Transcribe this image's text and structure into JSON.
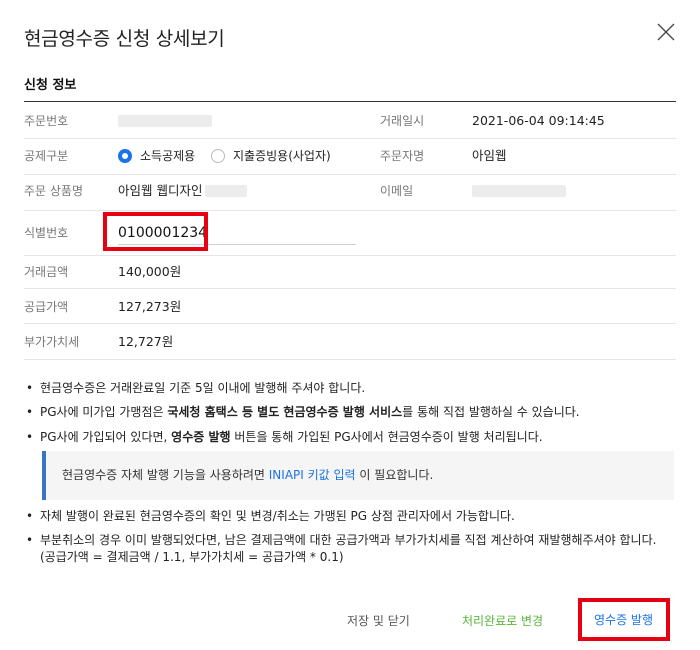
{
  "header": {
    "title": "현금영수증 신청 상세보기",
    "close_icon": "close-icon"
  },
  "section": {
    "title": "신청 정보"
  },
  "fields": {
    "order_no_label": "주문번호",
    "trade_date_label": "거래일시",
    "trade_date_value": "2021-06-04 09:14:45",
    "deduction_label": "공제구분",
    "deduction_options": [
      "소득공제용",
      "지출증빙용(사업자)"
    ],
    "orderer_label": "주문자명",
    "orderer_value": "아임웹",
    "product_label": "주문 상품명",
    "product_value": "아임웹 웹디자인",
    "email_label": "이메일",
    "id_label": "식별번호",
    "id_value": "0100001234",
    "amount_label": "거래금액",
    "amount_value": "140,000원",
    "supply_label": "공급가액",
    "supply_value": "127,273원",
    "vat_label": "부가가치세",
    "vat_value": "12,727원"
  },
  "notes": {
    "b1": "현금영수증은 거래완료일 기준 5일 이내에 발행해 주셔야 합니다.",
    "b2_pre": "PG사에 미가입 가맹점은 ",
    "b2_bold": "국세청 홈택스 등 별도 현금영수증 발행 서비스",
    "b2_post": "를 통해 직접 발행하실 수 있습니다.",
    "b3_pre": "PG사에 가입되어 있다면, ",
    "b3_bold": "영수증 발행",
    "b3_post": " 버튼을 통해 가입된 PG사에서 현금영수증이 발행 처리됩니다.",
    "info_pre": "현금영수증 자체 발행 기능을 사용하려면 ",
    "info_link": "INIAPI 키값 입력",
    "info_post": " 이 필요합니다.",
    "b4": "자체 발행이 완료된 현금영수증의 확인 및 변경/취소는 가맹된 PG 상점 관리자에서 가능합니다.",
    "b5_line1": "부분취소의 경우 이미 발행되었다면, 남은 결제금액에 대한 공급가액과 부가가치세를 직접 계산하여 재발행해주셔야 합니다.",
    "b5_line2": "(공급가액 = 결제금액 / 1.1, 부가가치세 = 공급가액 * 0.1)"
  },
  "footer": {
    "save_close": "저장 및 닫기",
    "mark_done": "처리완료로 변경",
    "issue_receipt": "영수증 발행"
  },
  "colors": {
    "accent": "#1a73e8",
    "highlight": "#e60012",
    "done_green": "#58b33b",
    "info_bar": "#3a72c4"
  }
}
